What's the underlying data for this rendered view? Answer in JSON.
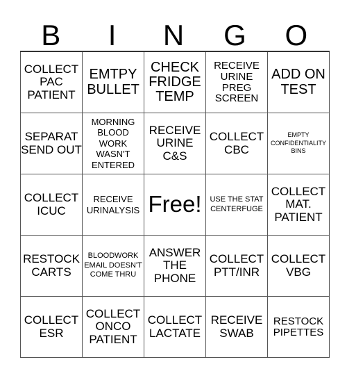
{
  "header": {
    "letters": [
      "B",
      "I",
      "N",
      "G",
      "O"
    ]
  },
  "rows": [
    [
      "COLLECT PAC PATIENT",
      "EMTPY BULLET",
      "CHECK FRIDGE TEMP",
      "RECEIVE URINE PREG SCREEN",
      "ADD ON TEST"
    ],
    [
      "SEPARAT SEND OUT",
      "MORNING BLOOD WORK WASN'T ENTERED",
      "RECEIVE URINE C&S",
      "COLLECT CBC",
      "EMPTY CONFIDENTIALITY BINS"
    ],
    [
      "COLLECT ICUC",
      "RECEIVE URINALYSIS",
      "Free!",
      "USE THE STAT CENTERFUGE",
      "COLLECT MAT. PATIENT"
    ],
    [
      "RESTOCK CARTS",
      "BLOODWORK EMAIL DOESN'T COME THRU",
      "ANSWER THE PHONE",
      "COLLECT PTT/INR",
      "COLLECT VBG"
    ],
    [
      "COLLECT ESR",
      "COLLECT ONCO PATIENT",
      "COLLECT LACTATE",
      "RECEIVE SWAB",
      "RESTOCK PIPETTES"
    ]
  ]
}
